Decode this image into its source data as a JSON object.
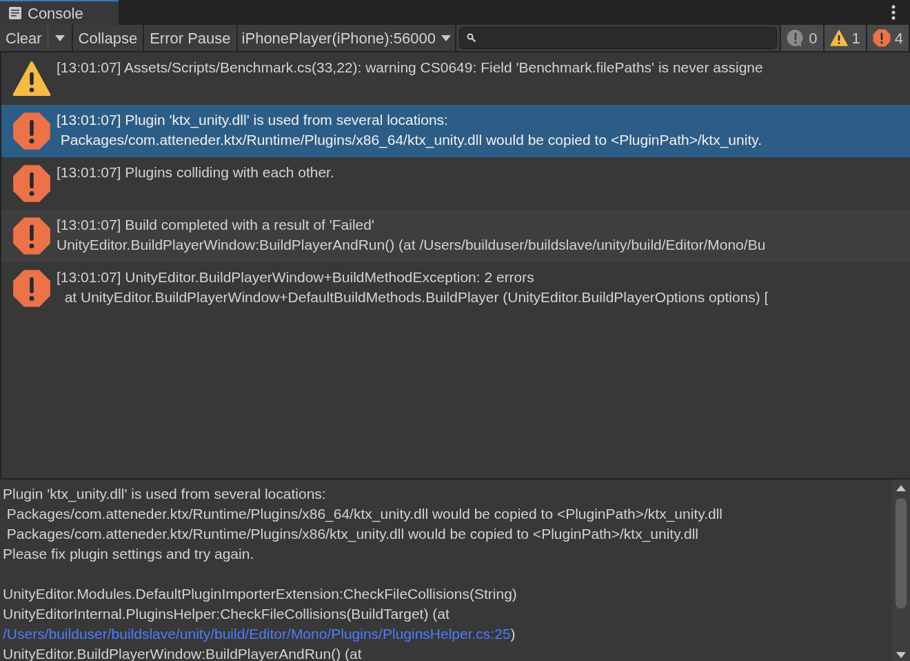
{
  "tab": {
    "title": "Console"
  },
  "toolbar": {
    "buttons": [
      "Clear",
      "Collapse",
      "Error Pause"
    ],
    "target": "iPhonePlayer(iPhone):56000",
    "counters": [
      {
        "kind": "info",
        "count": "0"
      },
      {
        "kind": "warning",
        "count": "1"
      },
      {
        "kind": "error",
        "count": "4"
      }
    ]
  },
  "entries": [
    {
      "kind": "warning",
      "selected": false,
      "lines": [
        "[13:01:07] Assets/Scripts/Benchmark.cs(33,22): warning CS0649: Field 'Benchmark.filePaths' is never assigne"
      ]
    },
    {
      "kind": "error",
      "selected": true,
      "lines": [
        "[13:01:07] Plugin 'ktx_unity.dll' is used from several locations:",
        " Packages/com.atteneder.ktx/Runtime/Plugins/x86_64/ktx_unity.dll would be copied to <PluginPath>/ktx_unity."
      ]
    },
    {
      "kind": "error",
      "selected": false,
      "lines": [
        "[13:01:07] Plugins colliding with each other."
      ]
    },
    {
      "kind": "error",
      "selected": false,
      "lines": [
        "[13:01:07] Build completed with a result of 'Failed'",
        "UnityEditor.BuildPlayerWindow:BuildPlayerAndRun() (at /Users/builduser/buildslave/unity/build/Editor/Mono/Bu"
      ]
    },
    {
      "kind": "error",
      "selected": false,
      "lines": [
        "[13:01:07] UnityEditor.BuildPlayerWindow+BuildMethodException: 2 errors",
        "  at UnityEditor.BuildPlayerWindow+DefaultBuildMethods.BuildPlayer (UnityEditor.BuildPlayerOptions options) ["
      ]
    }
  ],
  "details": {
    "lines": [
      {
        "text": "Plugin 'ktx_unity.dll' is used from several locations:"
      },
      {
        "text": " Packages/com.atteneder.ktx/Runtime/Plugins/x86_64/ktx_unity.dll would be copied to <PluginPath>/ktx_unity.dll"
      },
      {
        "text": " Packages/com.atteneder.ktx/Runtime/Plugins/x86/ktx_unity.dll would be copied to <PluginPath>/ktx_unity.dll"
      },
      {
        "text": "Please fix plugin settings and try again."
      },
      {
        "kind": "blank"
      },
      {
        "text": "UnityEditor.Modules.DefaultPluginImporterExtension:CheckFileCollisions(String)"
      },
      {
        "text": "UnityEditorInternal.PluginsHelper:CheckFileCollisions(BuildTarget) (at"
      },
      {
        "kind": "link",
        "link": "/Users/builduser/buildslave/unity/build/Editor/Mono/Plugins/PluginsHelper.cs:25",
        "text": ")"
      },
      {
        "text": "UnityEditor.BuildPlayerWindow:BuildPlayerAndRun() (at"
      }
    ]
  }
}
